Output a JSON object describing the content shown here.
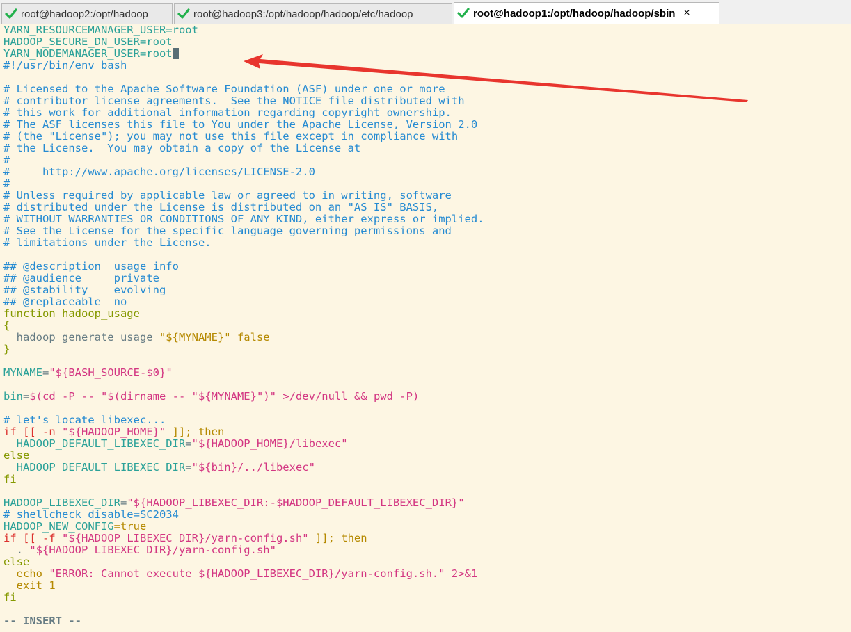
{
  "tabs": [
    {
      "label": "root@hadoop2:/opt/hadoop",
      "active": false
    },
    {
      "label": "root@hadoop3:/opt/hadoop/hadoop/etc/hadoop",
      "active": false
    },
    {
      "label": "root@hadoop1:/opt/hadoop/hadoop/sbin",
      "active": true
    }
  ],
  "close_label": "×",
  "icons": {
    "tab_status": "check-icon",
    "annotation": "red-arrow"
  },
  "colors": {
    "background": "#fdf6e3",
    "comment": "#268bd2",
    "variable": "#2aa198",
    "keyword": "#859900",
    "string": "#b58900",
    "arrow": "#e8352e"
  },
  "editor": {
    "added_lines": [
      {
        "name": "YARN_RESOURCEMANAGER_USER",
        "value": "=root"
      },
      {
        "name": "HADOOP_SECURE_DN_USER",
        "value": "=root"
      },
      {
        "name": "YARN_NODEMANAGER_USER",
        "value": "=root"
      }
    ],
    "shebang": "#!/usr/bin/env bash",
    "license": [
      "# Licensed to the Apache Software Foundation (ASF) under one or more",
      "# contributor license agreements.  See the NOTICE file distributed with",
      "# this work for additional information regarding copyright ownership.",
      "# The ASF licenses this file to You under the Apache License, Version 2.0",
      "# (the \"License\"); you may not use this file except in compliance with",
      "# the License.  You may obtain a copy of the License at",
      "#",
      "#     http://www.apache.org/licenses/LICENSE-2.0",
      "#",
      "# Unless required by applicable law or agreed to in writing, software",
      "# distributed under the License is distributed on an \"AS IS\" BASIS,",
      "# WITHOUT WARRANTIES OR CONDITIONS OF ANY KIND, either express or implied.",
      "# See the License for the specific language governing permissions and",
      "# limitations under the License."
    ],
    "desc": [
      "## @description  usage info",
      "## @audience     private",
      "## @stability    evolving",
      "## @replaceable  no"
    ],
    "fn_kw": "function",
    "fn_name": " hadoop_usage",
    "brace_open": "{",
    "usage_cmd": "  hadoop_generate_usage ",
    "usage_str": "\"${MYNAME}\"",
    "usage_false": " false",
    "brace_close": "}",
    "myname_var": "MYNAME",
    "myname_eq": "=",
    "myname_str": "\"${BASH_SOURCE-$0}\"",
    "bin_var": "bin",
    "bin_eq": "=",
    "bin_sub": "$(cd -P -- ",
    "bin_str1": "\"$(dirname -- ",
    "bin_str2": "\"${MYNAME}\"",
    "bin_str3": ")\"",
    "bin_rest": " >/dev/null && pwd -P)",
    "locate_comment": "# let's locate libexec...",
    "if1_kw": "if",
    "if1_body": " [[ -n ",
    "if1_str": "\"${HADOOP_HOME}\"",
    "if1_end": " ]]; then",
    "def1_var": "  HADOOP_DEFAULT_LIBEXEC_DIR",
    "def1_eq": "=",
    "def1_str": "\"${HADOOP_HOME}/libexec\"",
    "else1": "else",
    "def2_var": "  HADOOP_DEFAULT_LIBEXEC_DIR",
    "def2_eq": "=",
    "def2_str": "\"${bin}/../libexec\"",
    "fi1": "fi",
    "libexec_var": "HADOOP_LIBEXEC_DIR",
    "libexec_eq": "=",
    "libexec_str": "\"${HADOOP_LIBEXEC_DIR:-$HADOOP_DEFAULT_LIBEXEC_DIR}\"",
    "shellcheck": "# shellcheck disable=SC2034",
    "newconf_var": "HADOOP_NEW_CONFIG",
    "newconf_val": "=true",
    "if2_kw": "if",
    "if2_body": " [[ -f ",
    "if2_str": "\"${HADOOP_LIBEXEC_DIR}/yarn-config.sh\"",
    "if2_end": " ]]; then",
    "dot_cmd": "  . ",
    "dot_str": "\"${HADOOP_LIBEXEC_DIR}/yarn-config.sh\"",
    "else2": "else",
    "echo_cmd": "  echo ",
    "echo_str": "\"ERROR: Cannot execute ${HADOOP_LIBEXEC_DIR}/yarn-config.sh.\"",
    "echo_redir": " 2>&1",
    "exit_cmd": "  exit 1",
    "fi2": "fi",
    "mode": "-- INSERT --"
  }
}
